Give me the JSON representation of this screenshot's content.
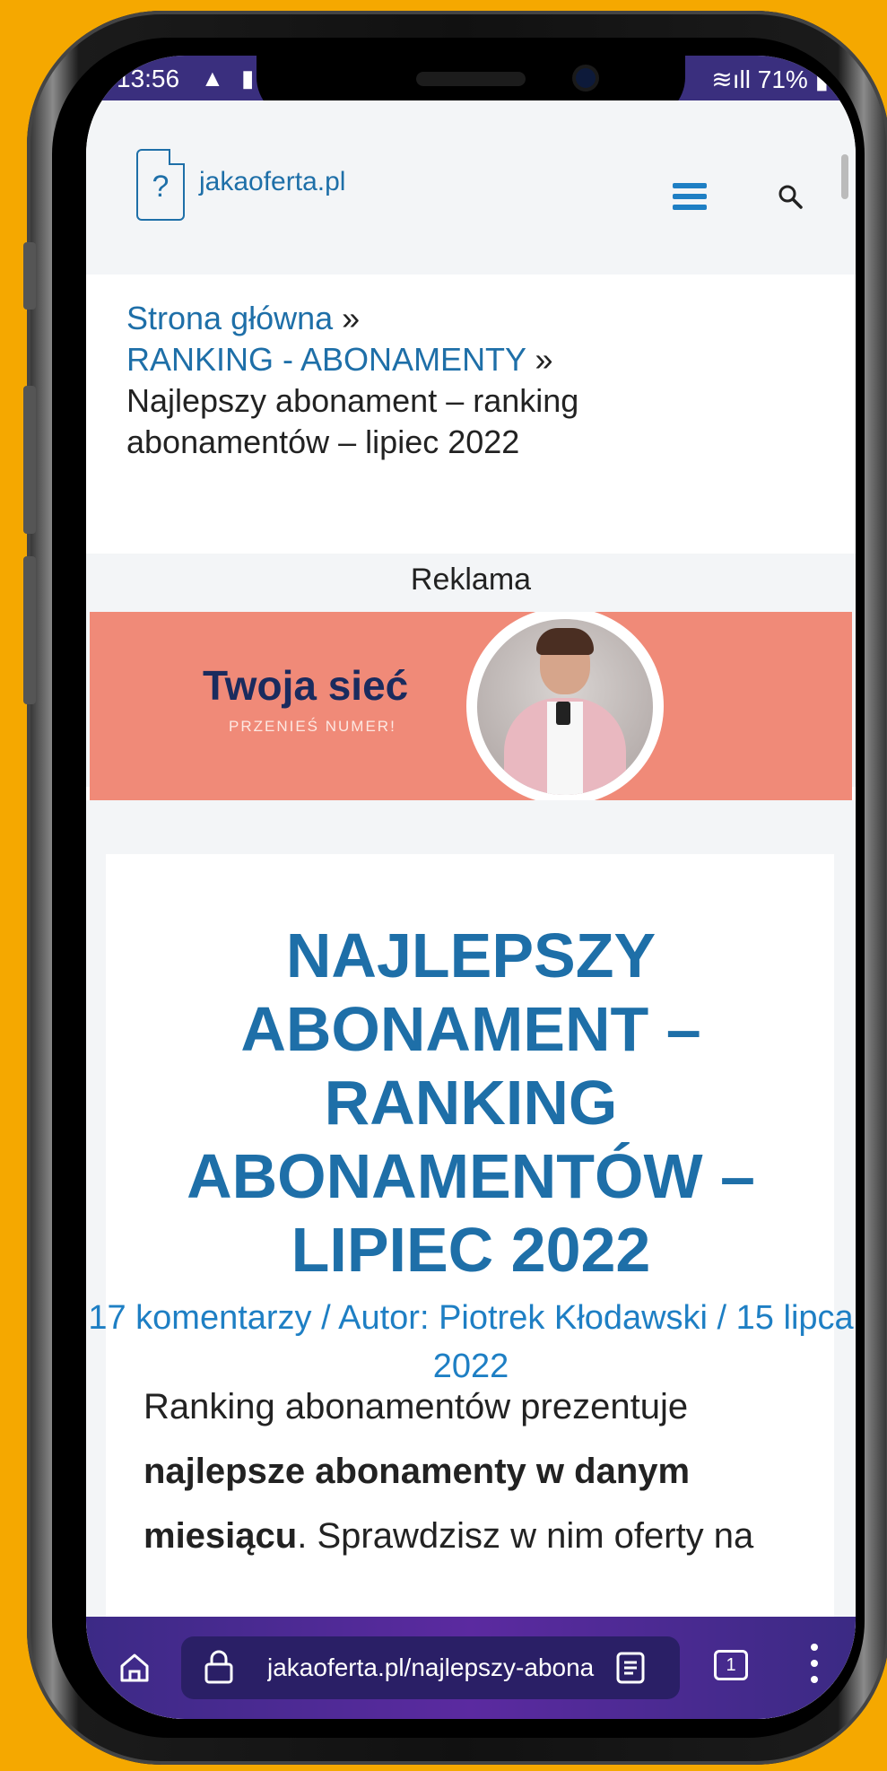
{
  "status_bar": {
    "time": "13:56",
    "battery": "71%"
  },
  "site": {
    "logo_mark": "?",
    "logo_text": "jakaoferta.pl"
  },
  "breadcrumb": {
    "home": "Strona główna",
    "sep": "»",
    "category": "RANKING - ABONAMENTY",
    "current": "Najlepszy abonament – ranking abonamentów – lipiec 2022"
  },
  "ad": {
    "label": "Reklama",
    "title": "Twoja sieć",
    "subtitle": "PRZENIEŚ NUMER!"
  },
  "article": {
    "title": "NAJLEPSZY ABONAMENT – RANKING ABONAMENTÓW – LIPIEC 2022",
    "comments": "17 komentarzy",
    "author": "Autor: Piotrek Kłodawski",
    "date": "15 lipca 2022",
    "body_part1": "Ranking abonamentów prezentuje ",
    "body_bold": "najlepsze abonamenty w danym miesiącu",
    "body_part2": ". Sprawdzisz w nim oferty na"
  },
  "browser": {
    "url": "jakaoferta.pl/najlepszy-abona",
    "tab_count": "1"
  },
  "colors": {
    "accent": "#1e6fa8",
    "ad_bg": "#F08A78",
    "background": "#F5A800"
  }
}
